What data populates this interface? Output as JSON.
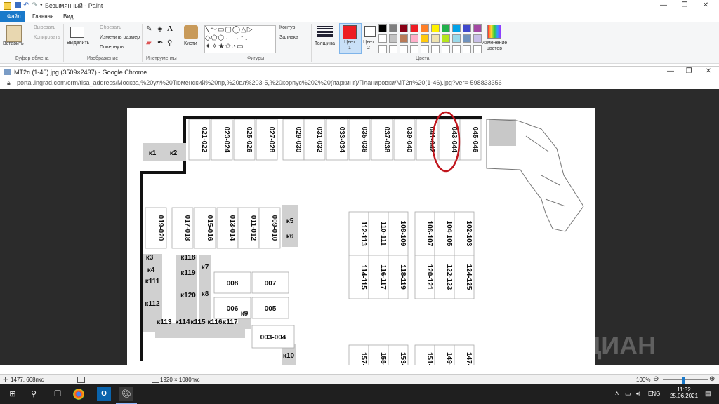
{
  "paint": {
    "title": "Безымянный - Paint",
    "tabs": [
      "Файл",
      "Главная",
      "Вид"
    ],
    "clipboard": {
      "paste": "Вставить",
      "cut": "Вырезать",
      "copy": "Копировать",
      "group": "Буфер обмена"
    },
    "image": {
      "select": "Выделить",
      "crop": "Обрезать",
      "resize": "Изменить размер",
      "rotate": "Повернуть",
      "group": "Изображение"
    },
    "tools": {
      "group": "Инструменты",
      "brushes": "Кисти"
    },
    "shapes": {
      "group": "Фигуры",
      "outline": "Контур",
      "fill": "Заливка"
    },
    "size": "Толщина",
    "color1": "Цвет\n1",
    "color1_a": "Цвет",
    "color1_b": "1",
    "color2_a": "Цвет",
    "color2_b": "2",
    "colors_group": "Цвета",
    "edit_colors_a": "Изменение",
    "edit_colors_b": "цветов",
    "palette": [
      "#000000",
      "#7f7f7f",
      "#880015",
      "#ed1c24",
      "#ff7f27",
      "#fff200",
      "#22b14c",
      "#00a2e8",
      "#3f48cc",
      "#a349a4",
      "#ffffff",
      "#c3c3c3",
      "#b97a57",
      "#ffaec9",
      "#ffc90e",
      "#efe4b0",
      "#b5e61d",
      "#99d9ea",
      "#7092be",
      "#c8bfe7"
    ],
    "status_pos": "1477, 668пкс",
    "status_size": "1920 × 1080пкс",
    "zoom": "100%"
  },
  "chrome": {
    "title": "МТ2п (1-46).jpg (3509×2437) - Google Chrome",
    "url": "portal.ingrad.com/crm/tisa_address/Москва,%20ул%20Тюменский%20пр,%20вл%203-5,%20корпус%202%20(паркинг)/Планировки/МТ2п%20(1-46).jpg?ver=-598833356"
  },
  "plan": {
    "top_spots": [
      "021-022",
      "023-024",
      "025-026",
      "027-028",
      "029-030",
      "031-032",
      "033-034",
      "035-036",
      "037-038",
      "039-040",
      "041-042",
      "043-044",
      "045-046"
    ],
    "mid_spots": [
      "019-020",
      "017-018",
      "015-016",
      "013-014",
      "011-012",
      "009-010"
    ],
    "block_top": [
      "112-113",
      "110-111",
      "108-109",
      "106-107",
      "104-105",
      "102-103"
    ],
    "block_bottom": [
      "114-115",
      "116-117",
      "118-119",
      "120-121",
      "122-123",
      "124-125"
    ],
    "bottom_spots": [
      "157-",
      "155-",
      "153-",
      "151-",
      "149-",
      "147-"
    ],
    "horizontal": [
      "008",
      "007",
      "006",
      "005",
      "003-004"
    ],
    "storage": [
      "к1",
      "к2",
      "к3",
      "к4",
      "к111",
      "к112",
      "к118",
      "к119",
      "к120",
      "к7",
      "к8",
      "к9",
      "к113",
      "к114",
      "к115",
      "к116",
      "к117",
      "к5",
      "к6",
      "к10"
    ],
    "highlighted": "043-044"
  },
  "taskbar": {
    "lang": "ENG",
    "time": "11:32",
    "date": "25.06.2021"
  }
}
